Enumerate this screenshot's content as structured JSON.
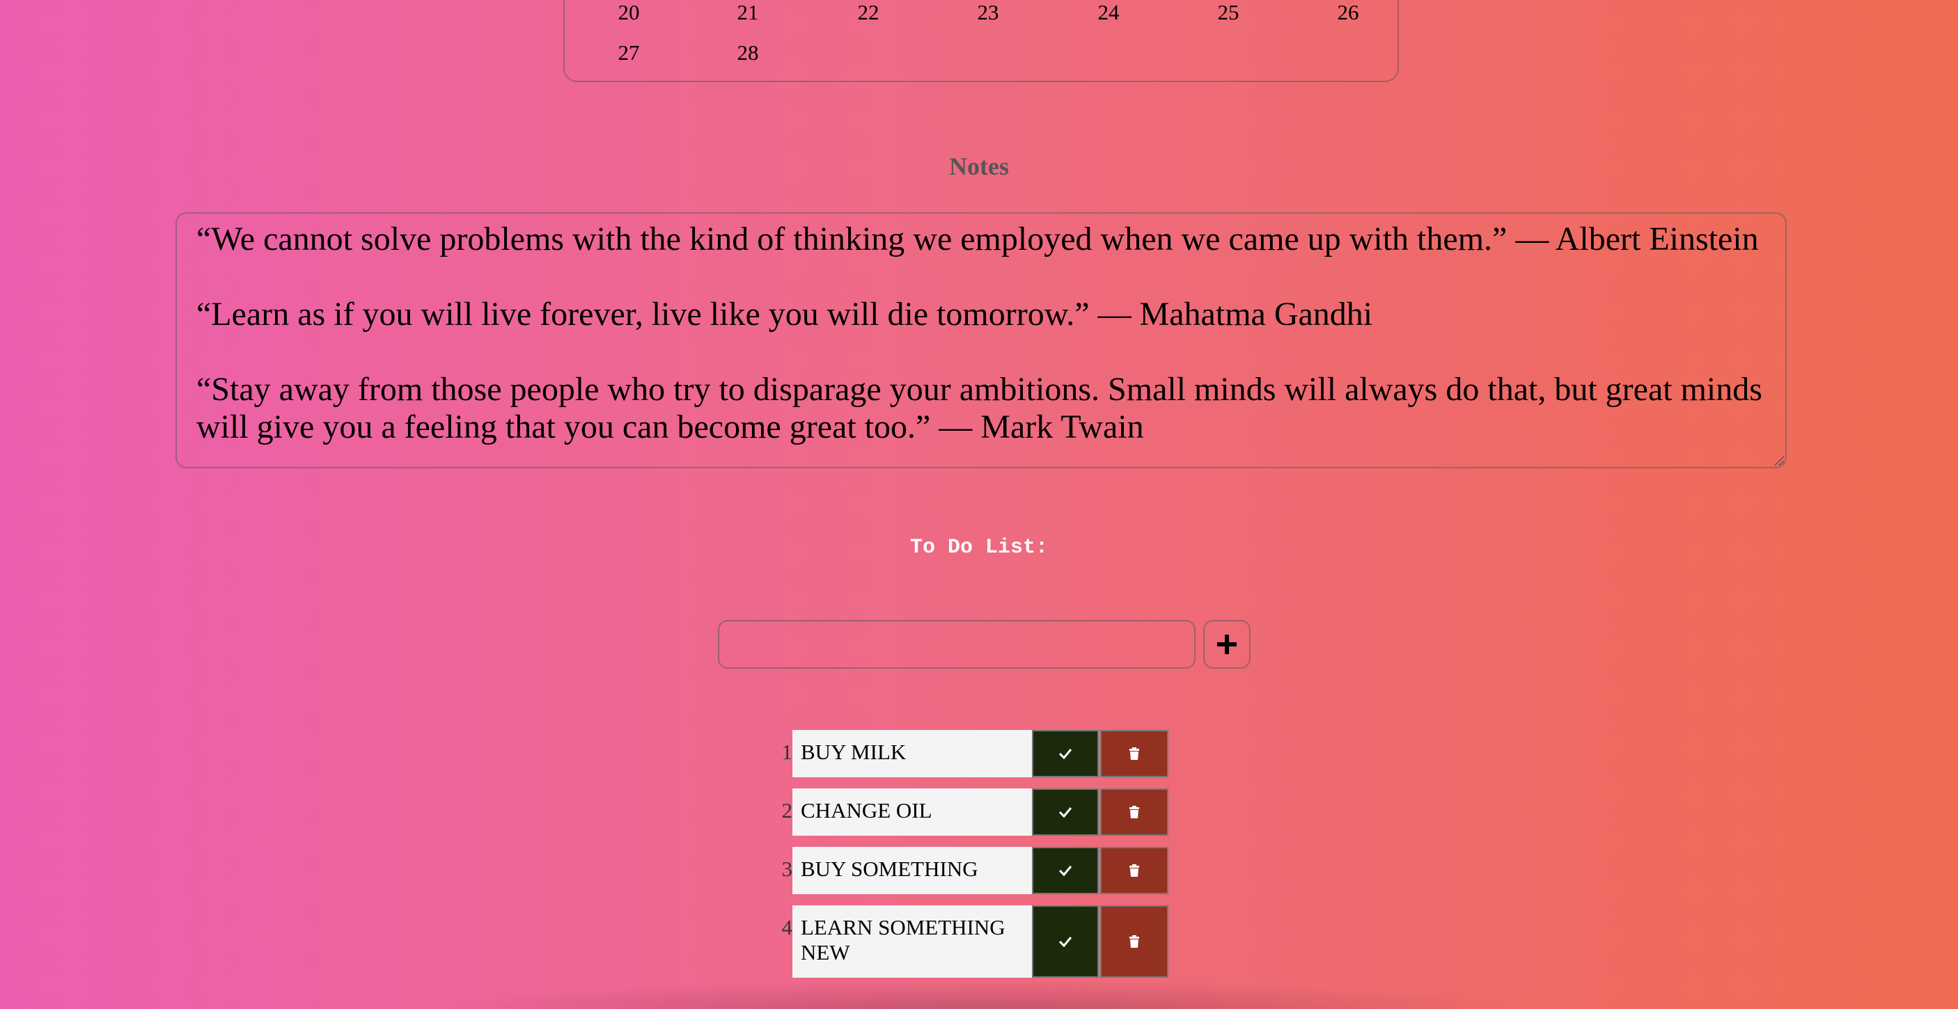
{
  "calendar": {
    "rows": [
      [
        "20",
        "21",
        "22",
        "23",
        "24",
        "25",
        "26"
      ],
      [
        "27",
        "28"
      ]
    ]
  },
  "notes": {
    "title": "Notes",
    "lines": [
      "“We cannot solve problems with the kind of thinking we employed when we came up with them.” — Albert Einstein",
      "“Learn as if you will live forever, live like you will die tomorrow.” — Mahatma Gandhi",
      "“Stay away from those people who try to disparage your ambitions. Small minds will always do that, but great minds will give you a feeling that you can become great too.” — Mark Twain"
    ]
  },
  "todo": {
    "title": "To Do List:",
    "input_value": "",
    "add_icon": "plus-icon",
    "done_icon": "check-icon",
    "delete_icon": "trash-icon",
    "items": [
      {
        "num": "1",
        "text": "BUY MILK"
      },
      {
        "num": "2",
        "text": "CHANGE OIL"
      },
      {
        "num": "3",
        "text": "BUY SOMETHING"
      },
      {
        "num": "4",
        "text": "LEARN SOMETHING NEW"
      }
    ]
  },
  "colors": {
    "done_button": "#1c2a0c",
    "delete_button": "#933120",
    "item_bg": "#f4f4f4"
  }
}
